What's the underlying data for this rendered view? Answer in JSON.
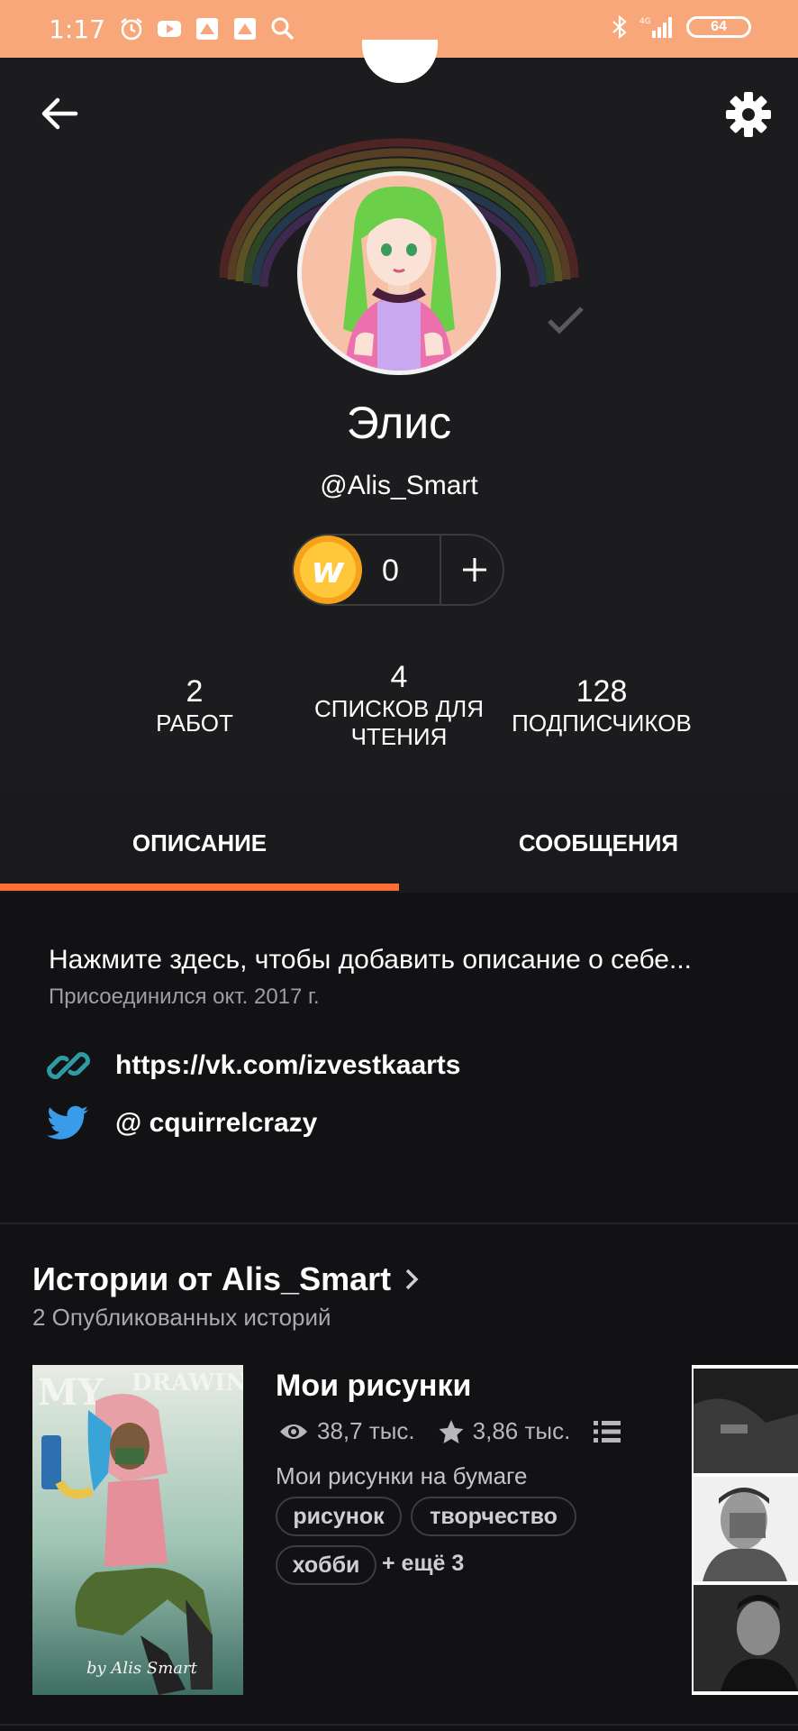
{
  "status_bar": {
    "time": "1:17",
    "battery": "64",
    "network": "4G"
  },
  "profile": {
    "name": "Элис",
    "handle": "@Alis_Smart",
    "coins": "0"
  },
  "stats": [
    {
      "num": "2",
      "label": "РАБОТ"
    },
    {
      "num": "4",
      "label_1": "СПИСКОВ ДЛЯ",
      "label_2": "ЧТЕНИЯ"
    },
    {
      "num": "128",
      "label": "ПОДПИСЧИКОВ"
    }
  ],
  "tabs": [
    {
      "label": "ОПИСАНИЕ",
      "active": true
    },
    {
      "label": "СООБЩЕНИЯ",
      "active": false
    }
  ],
  "about": {
    "description": "Нажмите здесь, чтобы добавить описание о себе...",
    "joined": "Присоединился окт. 2017 г.",
    "link": "https://vk.com/izvestkaarts",
    "twitter": "@ cquirrelcrazy"
  },
  "stories_section": {
    "title": "Истории от Alis_Smart",
    "subtitle": "2 Опубликованных историй"
  },
  "story": {
    "title": "Мои рисунки",
    "reads": "38,7 тыс.",
    "votes": "3,86 тыс.",
    "description": "Мои рисунки на бумаге",
    "tags": [
      "рисунок",
      "творчество",
      "хобби"
    ],
    "more_tags": "+ ещё 3",
    "cover_text": {
      "top_left": "MY",
      "top_right": "DRAWING",
      "signature": "by Alis Smart"
    }
  },
  "colors": {
    "accent": "#ff6c36",
    "status_bar": "#f7a77a",
    "background": "#121114",
    "header": "#1c1b1d"
  }
}
